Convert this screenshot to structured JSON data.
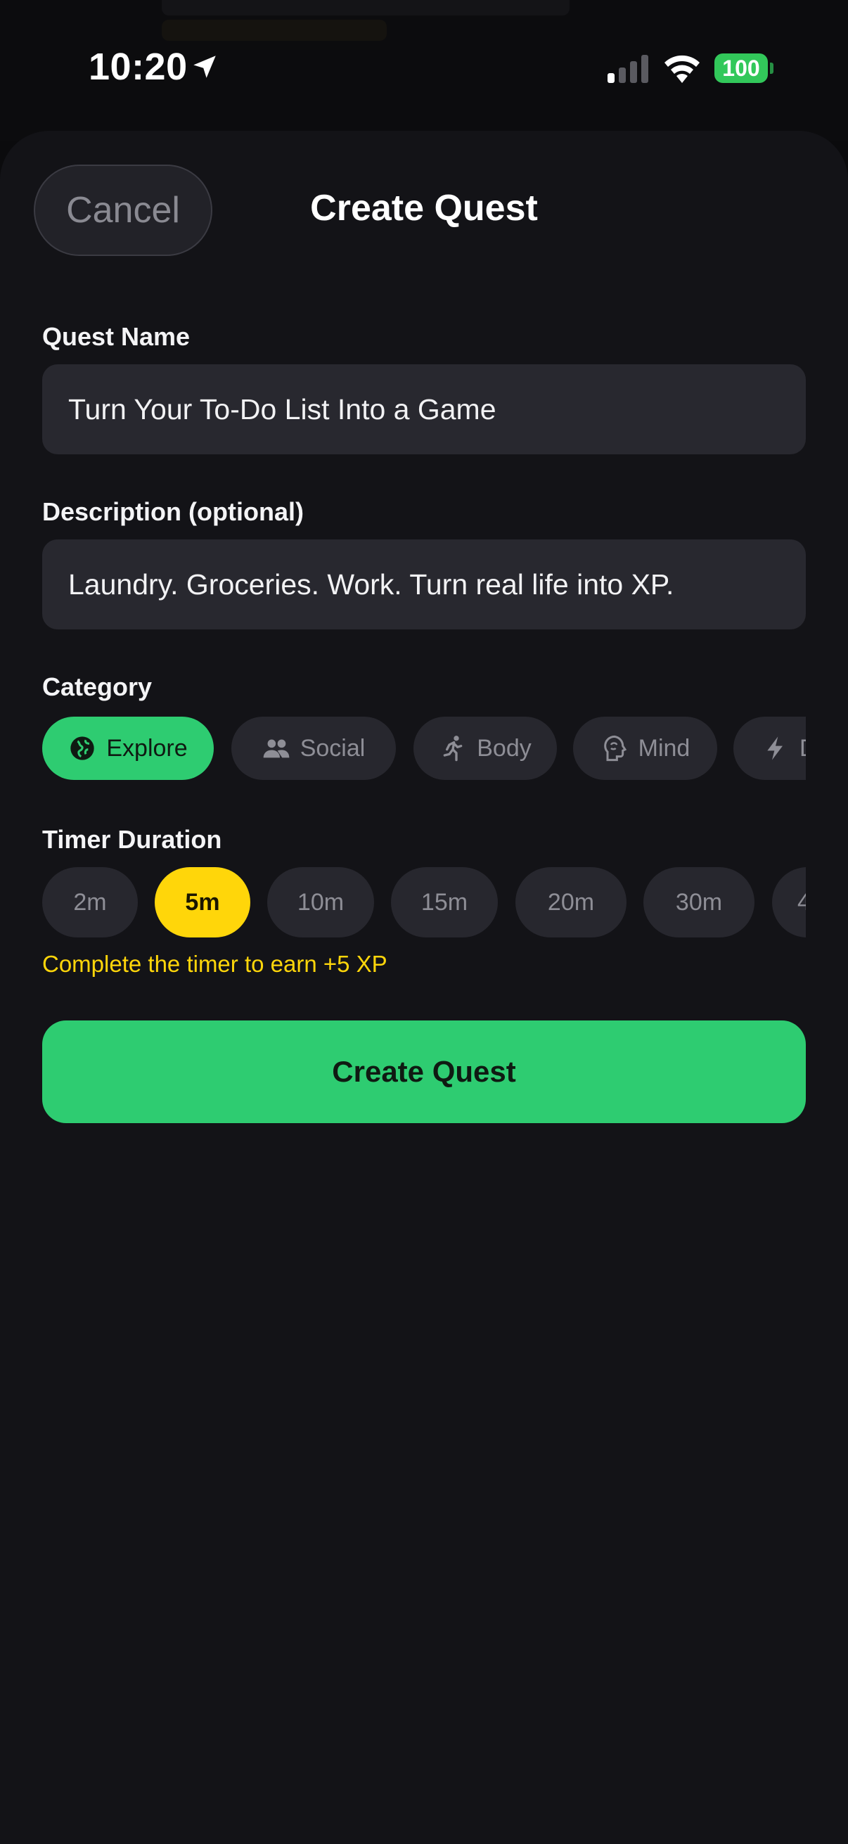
{
  "status_bar": {
    "time": "10:20",
    "battery": "100"
  },
  "sheet": {
    "title": "Create Quest",
    "cancel_label": "Cancel"
  },
  "form": {
    "quest_name": {
      "label": "Quest Name",
      "value": "Turn Your To-Do List Into a Game"
    },
    "description": {
      "label": "Description (optional)",
      "value": "Laundry. Groceries. Work. Turn real life into XP."
    },
    "category": {
      "label": "Category",
      "options": [
        {
          "label": "Explore",
          "icon": "globe-icon",
          "selected": true
        },
        {
          "label": "Social",
          "icon": "people-icon",
          "selected": false
        },
        {
          "label": "Body",
          "icon": "runner-icon",
          "selected": false
        },
        {
          "label": "Mind",
          "icon": "brain-icon",
          "selected": false
        },
        {
          "label": "D",
          "icon": "bolt-icon",
          "selected": false
        }
      ]
    },
    "timer": {
      "label": "Timer Duration",
      "options": [
        "2m",
        "5m",
        "10m",
        "15m",
        "20m",
        "30m",
        "4"
      ],
      "selected": "5m",
      "hint": "Complete the timer to earn +5 XP"
    },
    "submit_label": "Create Quest"
  },
  "colors": {
    "accent_green": "#2ecc71",
    "accent_yellow": "#ffd60a",
    "background": "#131317",
    "field": "#28282f"
  }
}
